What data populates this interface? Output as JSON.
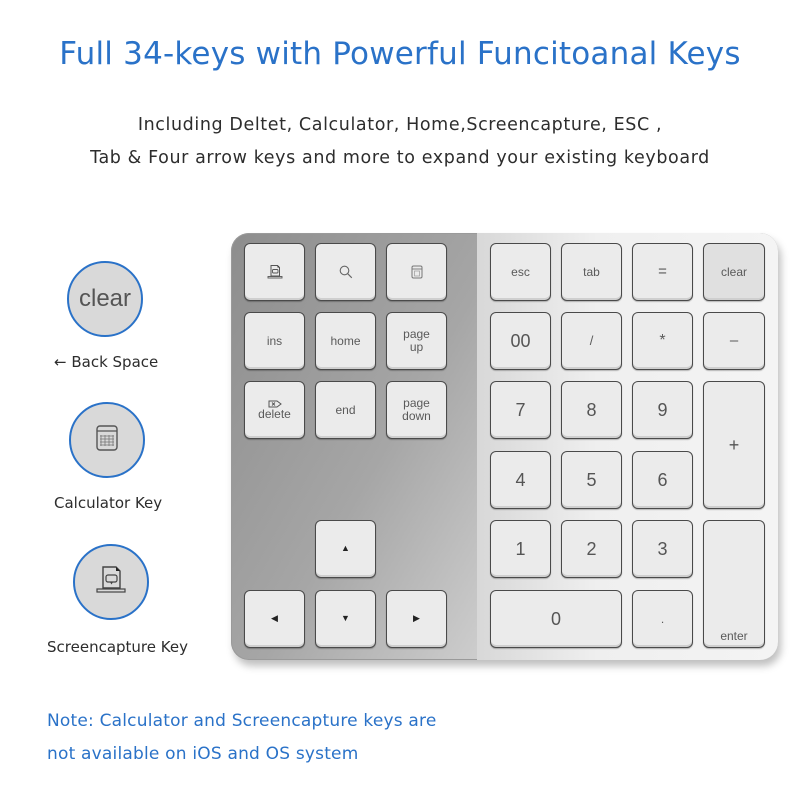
{
  "header": {
    "title": "Full 34-keys with Powerful Funcitoanal Keys",
    "subtitle_line1": "Including Deltet, Calculator, Home,Screencapture, ESC ,",
    "subtitle_line2": "Tab & Four arrow keys and more to expand your existing keyboard"
  },
  "features": [
    {
      "circle_text": "clear",
      "label": "← Back Space",
      "icon": "clear-text"
    },
    {
      "circle_text": "",
      "label": "Calculator Key",
      "icon": "calculator-icon"
    },
    {
      "circle_text": "",
      "label": "Screencapture Key",
      "icon": "screencapture-icon"
    }
  ],
  "keyboard": {
    "left_block": {
      "row1": [
        {
          "label": "",
          "icon": "screencapture-icon"
        },
        {
          "label": "",
          "icon": "search-icon"
        },
        {
          "label": "",
          "icon": "calculator-icon"
        }
      ],
      "row2": [
        {
          "label": "ins"
        },
        {
          "label": "home"
        },
        {
          "label": "page\nup",
          "line1": "page",
          "line2": "up"
        }
      ],
      "row3": [
        {
          "label": "delete",
          "icon": "delete-tag-icon"
        },
        {
          "label": "end"
        },
        {
          "label": "page\ndown",
          "line1": "page",
          "line2": "down"
        }
      ]
    },
    "arrows": {
      "up": "▲",
      "left": "◀",
      "down": "▼",
      "right": "▶"
    },
    "numpad": {
      "row1": [
        "esc",
        "tab",
        "=",
        "clear"
      ],
      "row2": [
        "00",
        "/",
        "*",
        "–"
      ],
      "row3": [
        "7",
        "8",
        "9",
        "+"
      ],
      "row4": [
        "4",
        "5",
        "6"
      ],
      "row5": [
        "1",
        "2",
        "3"
      ],
      "row6": [
        "0",
        "."
      ],
      "enter": "enter"
    }
  },
  "note": {
    "line1": "Note: Calculator and Screencapture keys are",
    "line2": "not available on iOS and OS system"
  },
  "colors": {
    "accent_blue": "#2a72c8",
    "text_dark": "#2d2d2d",
    "key_face": "#ebebeb",
    "circle_fill": "#d9d9d9"
  }
}
